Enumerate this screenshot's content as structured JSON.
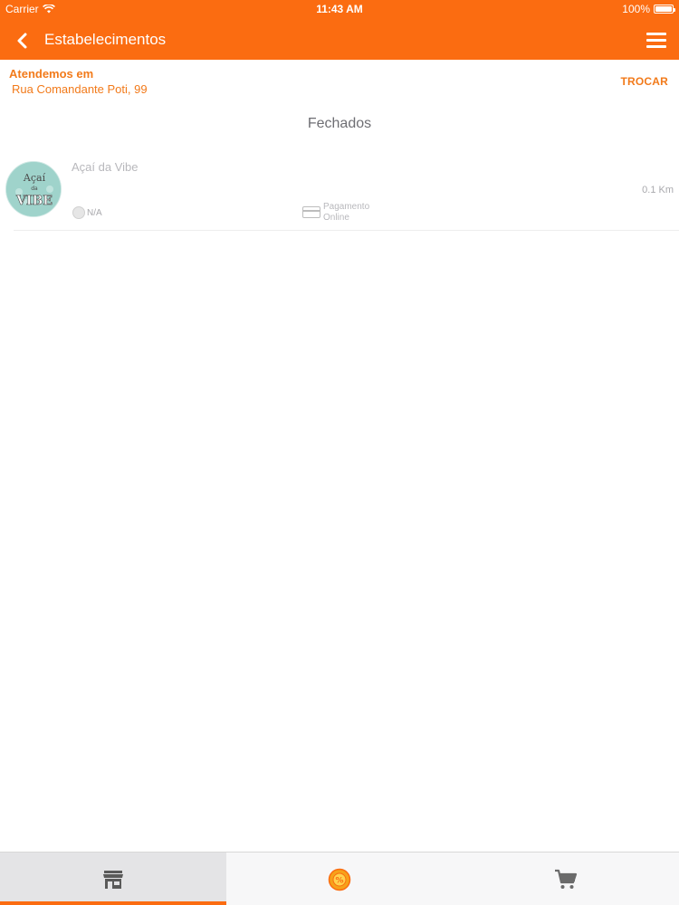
{
  "status_bar": {
    "carrier": "Carrier",
    "time": "11:43 AM",
    "battery": "100%",
    "battery_level": 1.0
  },
  "nav": {
    "title": "Estabelecimentos",
    "back_icon": "chevron-left-icon",
    "menu_icon": "hamburger-menu-icon"
  },
  "address": {
    "label": "Atendemos em",
    "street": "Rua Comandante Poti, 99",
    "change_label": "TROCAR"
  },
  "section": {
    "title": "Fechados"
  },
  "stores": [
    {
      "name": "Açaí da Vibe",
      "logo_line1": "Açaí",
      "logo_line2": "da",
      "logo_line3": "VIBE",
      "distance": "0.1 Km",
      "rating": "N/A",
      "payment": "Pagamento Online"
    }
  ],
  "tabbar": {
    "tabs": [
      {
        "icon": "store-icon",
        "active": true
      },
      {
        "icon": "promotion-badge-icon",
        "active": false
      },
      {
        "icon": "cart-icon",
        "active": false
      }
    ]
  },
  "colors": {
    "brand": "#fb6c11",
    "accent_text": "#f27a1a"
  }
}
